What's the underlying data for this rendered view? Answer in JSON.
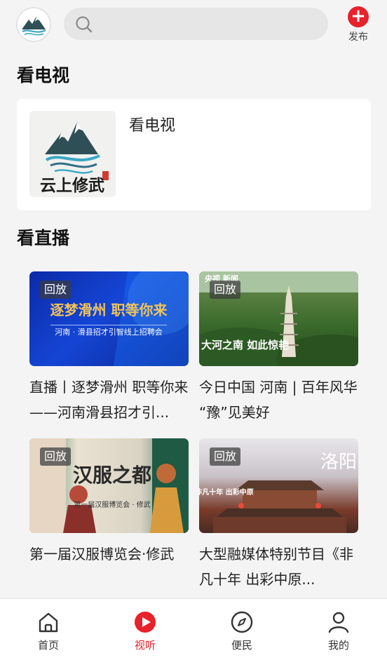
{
  "header": {
    "publish_label": "发布"
  },
  "colors": {
    "accent": "#e8212b",
    "background": "#f4f4f4"
  },
  "tv_section": {
    "title": "看电视",
    "card": {
      "name": "看电视",
      "logo_text": "云上修武"
    }
  },
  "live_section": {
    "title": "看直播",
    "items": [
      {
        "badge": "回放",
        "title": "直播丨逐梦滑州 职等你来——河南滑县招才引...",
        "thumb_headline": "逐梦滑州 职等你来",
        "thumb_sub": "河南 · 滑县招才引智线上招聘会"
      },
      {
        "badge": "回放",
        "title": "今日中国 河南 | 百年风华 “豫”见美好",
        "thumb_headline": "看我 大河之南 如此惊艳",
        "thumb_corner": "央视 新闻"
      },
      {
        "badge": "回放",
        "title": "第一届汉服博览会·修武",
        "thumb_headline": "汉服之都",
        "thumb_sub": "第一届汉服博览会 · 修武"
      },
      {
        "badge": "回放",
        "title": "大型融媒体特别节目《非凡十年 出彩中原...",
        "thumb_headline": "洛阳",
        "thumb_sub": "非凡十年 出彩中原"
      }
    ]
  },
  "bottom_nav": [
    {
      "label": "首页",
      "icon": "home-icon",
      "active": false
    },
    {
      "label": "视听",
      "icon": "play-icon",
      "active": true
    },
    {
      "label": "便民",
      "icon": "compass-icon",
      "active": false
    },
    {
      "label": "我的",
      "icon": "user-icon",
      "active": false
    }
  ]
}
